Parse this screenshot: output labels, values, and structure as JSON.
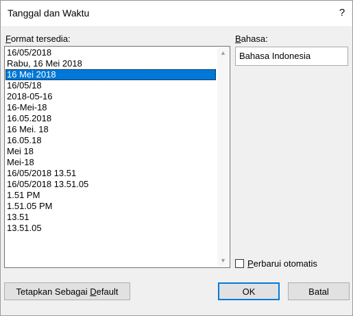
{
  "window": {
    "title": "Tanggal dan Waktu",
    "help_label": "?"
  },
  "formats": {
    "label_accel": "F",
    "label_rest": "ormat tersedia:",
    "items": [
      "16/05/2018",
      "Rabu, 16 Mei 2018",
      "16 Mei 2018",
      "16/05/18",
      "2018-05-16",
      "16-Mei-18",
      "16.05.2018",
      "16 Mei. 18",
      "16.05.18",
      "Mei 18",
      "Mei-18",
      "16/05/2018 13.51",
      "16/05/2018 13.51.05",
      "1.51 PM",
      "1.51.05 PM",
      "13.51",
      "13.51.05"
    ],
    "selected_index": 2,
    "scroll_up_icon": "▲",
    "scroll_down_icon": "▼"
  },
  "language": {
    "label_accel": "B",
    "label_rest": "ahasa:",
    "value": "Bahasa Indonesia"
  },
  "auto_update": {
    "label_accel": "P",
    "label_rest": "erbarui otomatis",
    "checked": false
  },
  "buttons": {
    "set_default_pre": "Tetapkan Sebagai ",
    "set_default_accel": "D",
    "set_default_post": "efault",
    "ok": "OK",
    "cancel": "Batal"
  }
}
